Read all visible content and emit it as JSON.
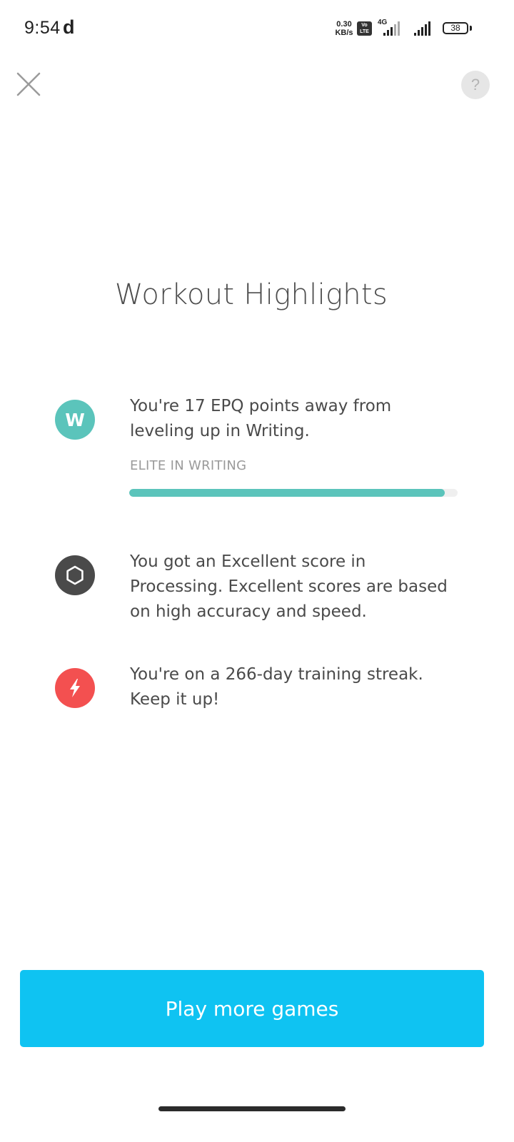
{
  "status_bar": {
    "time": "9:54",
    "notification_glyph": "d",
    "net_speed_value": "0.30",
    "net_speed_unit": "KB/s",
    "volte_line1": "Vo",
    "volte_line2": "LTE",
    "network_type": "4G",
    "battery_level": "38"
  },
  "header": {
    "close_icon": "close-icon",
    "help_label": "?"
  },
  "title": "Workout Highlights",
  "highlights": [
    {
      "icon": "W",
      "icon_color": "#5bc4bb",
      "text": "You're 17 EPQ points away from leveling up in Writing.",
      "level_label": "ELITE IN WRITING",
      "progress_fraction": 0.96,
      "progress_color": "#5bc4bb"
    },
    {
      "icon": "hexagon-icon",
      "icon_color": "#4a4a4a",
      "text": "You got an Excellent score in Processing. Excellent scores are based on high accuracy and speed."
    },
    {
      "icon": "lightning-bolt-icon",
      "icon_color": "#f35050",
      "text": "You're on a 266-day training streak. Keep it up!"
    }
  ],
  "cta": {
    "label": "Play more games",
    "color": "#0fc3f2"
  }
}
